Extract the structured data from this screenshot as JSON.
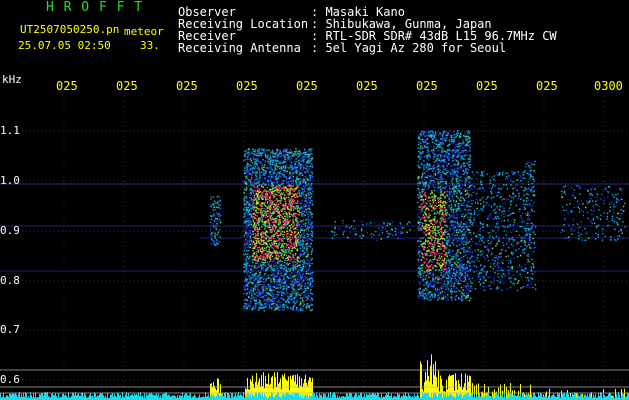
{
  "header": {
    "brand": "H R O F F T",
    "filename": "UT2507050250.pn",
    "mode": "meteor",
    "datetime": "25.07.05 02:50",
    "count": "33.",
    "info_labels": [
      "Observer",
      "Receiving Location",
      "Receiver",
      "Receiving Antenna"
    ],
    "info_values": [
      ": Masaki Kano",
      ": Shibukawa, Gunma, Japan",
      ": RTL-SDR SDR# 43dB L15 96.7MHz CW",
      ": 5el Yagi Az 280 for Seoul"
    ]
  },
  "axes": {
    "y_unit": "kHz",
    "y_ticks": [
      "1.1",
      "1.0",
      "0.9",
      "0.8",
      "0.7",
      "0.6"
    ],
    "x_ticks": [
      "025",
      "025",
      "025",
      "025",
      "025",
      "025",
      "025",
      "025",
      "025",
      "0300"
    ]
  },
  "colors": {
    "label_white": "#ffffff",
    "label_yellow": "#ffff00",
    "brand_green": "#22dd22",
    "mode_cyan": "#00ffff",
    "background": "#000000"
  }
}
